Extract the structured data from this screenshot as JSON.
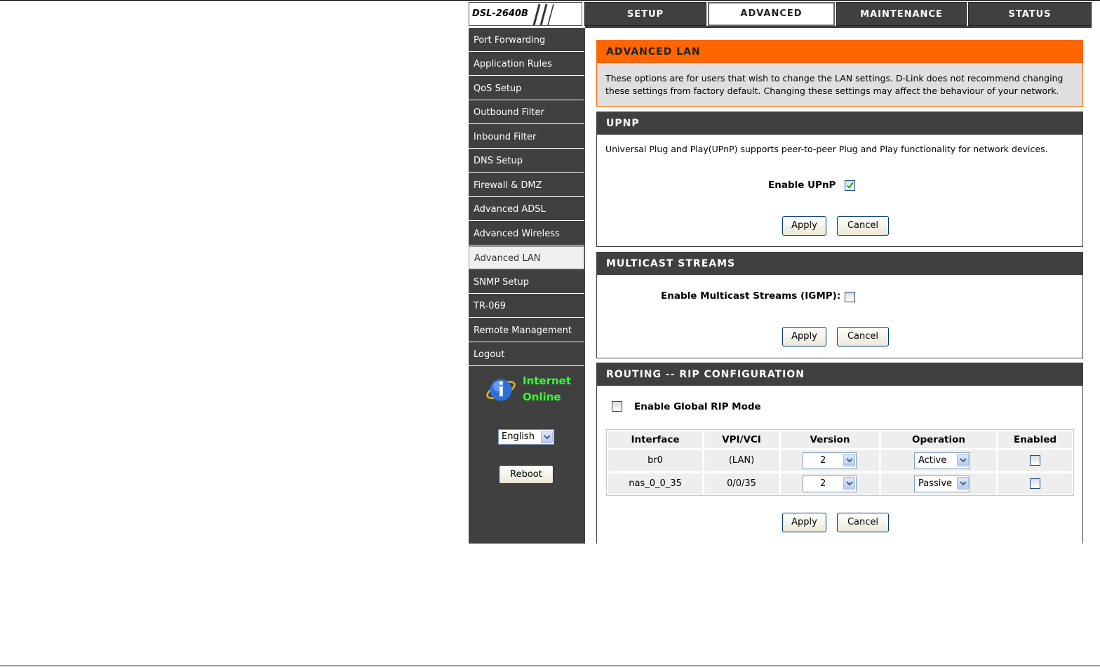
{
  "device": {
    "model": "DSL-2640B"
  },
  "tabs": [
    {
      "label": "SETUP"
    },
    {
      "label": "ADVANCED"
    },
    {
      "label": "MAINTENANCE"
    },
    {
      "label": "STATUS"
    }
  ],
  "sidebar": {
    "items": [
      {
        "label": "Port Forwarding"
      },
      {
        "label": "Application Rules"
      },
      {
        "label": "QoS Setup"
      },
      {
        "label": "Outbound Filter"
      },
      {
        "label": "Inbound Filter"
      },
      {
        "label": "DNS Setup"
      },
      {
        "label": "Firewall & DMZ"
      },
      {
        "label": "Advanced ADSL"
      },
      {
        "label": "Advanced Wireless"
      },
      {
        "label": "Advanced LAN"
      },
      {
        "label": "SNMP Setup"
      },
      {
        "label": "TR-069"
      },
      {
        "label": "Remote Management"
      },
      {
        "label": "Logout"
      }
    ],
    "status_line1": "Internet",
    "status_line2": "Online",
    "language": "English",
    "reboot_label": "Reboot"
  },
  "intro": {
    "title": "ADVANCED LAN",
    "line1": "These options are for users that wish to change the LAN settings. D-Link does not recommend changing",
    "line2": "these settings from factory default. Changing these settings may affect the behaviour of your network."
  },
  "upnp": {
    "title": "UPNP",
    "description": "Universal Plug and Play(UPnP) supports peer-to-peer Plug and Play functionality for network devices.",
    "enable_label": "Enable UPnP",
    "enabled": true,
    "apply_label": "Apply",
    "cancel_label": "Cancel"
  },
  "multicast": {
    "title": "MULTICAST STREAMS",
    "enable_label": "Enable Multicast Streams (IGMP):",
    "enabled": false,
    "apply_label": "Apply",
    "cancel_label": "Cancel"
  },
  "rip": {
    "title": "ROUTING -- RIP CONFIGURATION",
    "global_label": "Enable Global RIP Mode",
    "global_enabled": false,
    "columns": [
      "Interface",
      "VPI/VCI",
      "Version",
      "Operation",
      "Enabled"
    ],
    "rows": [
      {
        "interface": "br0",
        "vpi_vci": "(LAN)",
        "version": "2",
        "operation": "Active",
        "enabled": false
      },
      {
        "interface": "nas_0_0_35",
        "vpi_vci": "0/0/35",
        "version": "2",
        "operation": "Passive",
        "enabled": false
      }
    ],
    "apply_label": "Apply",
    "cancel_label": "Cancel"
  },
  "colors": {
    "nav_bg": "#404040",
    "accent_orange": "#ff6600",
    "status_green": "#33ff33"
  }
}
